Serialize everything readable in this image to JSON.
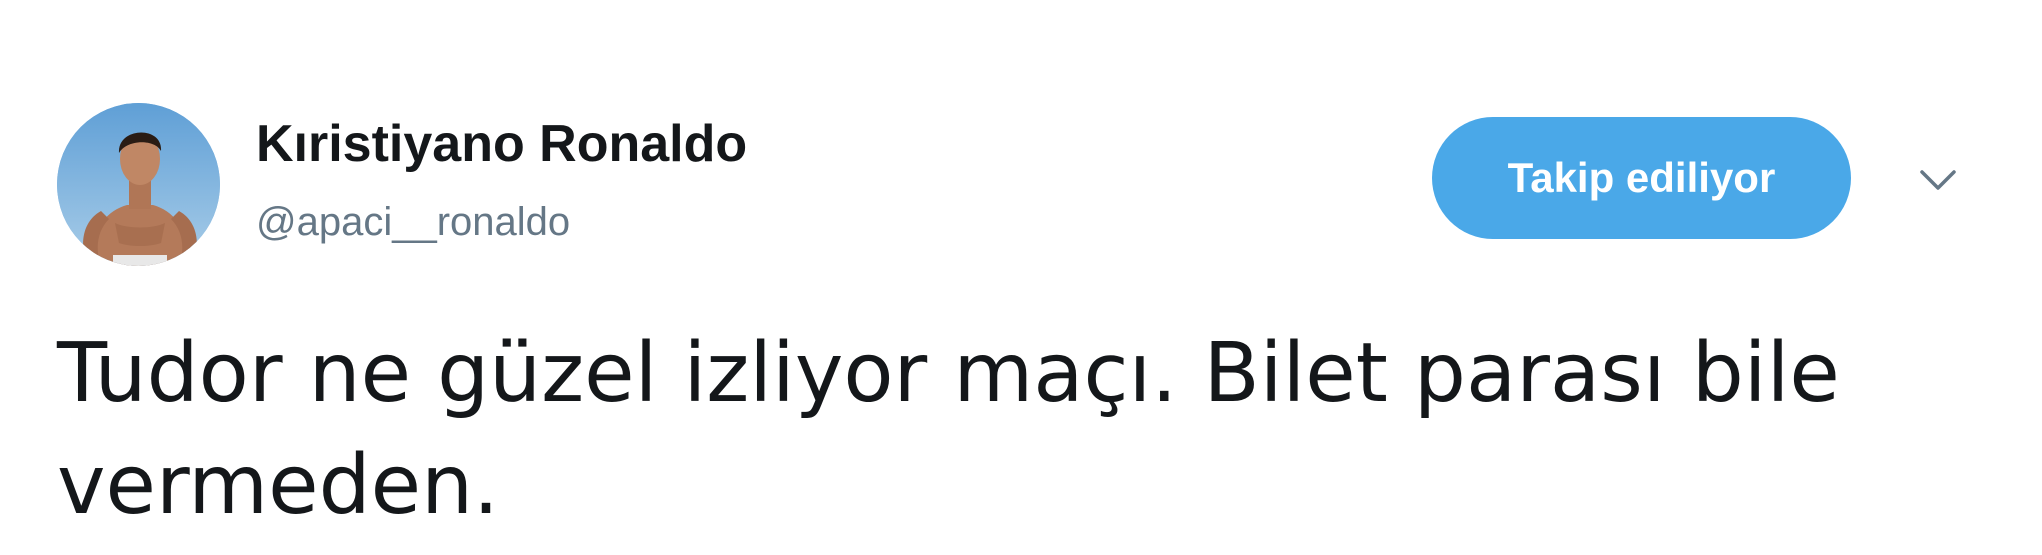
{
  "tweet": {
    "author": {
      "display_name": "Kıristiyano Ronaldo",
      "handle": "@apaci__ronaldo",
      "avatar_icon": "profile-photo"
    },
    "follow_button_label": "Takip ediliyor",
    "menu_icon": "chevron-down-icon",
    "text": "Tudor ne güzel izliyor maçı. Bilet parası bile vermeden."
  },
  "colors": {
    "accent": "#4aa8e8",
    "text_primary": "#14171a",
    "text_secondary": "#657786",
    "background": "#ffffff"
  }
}
